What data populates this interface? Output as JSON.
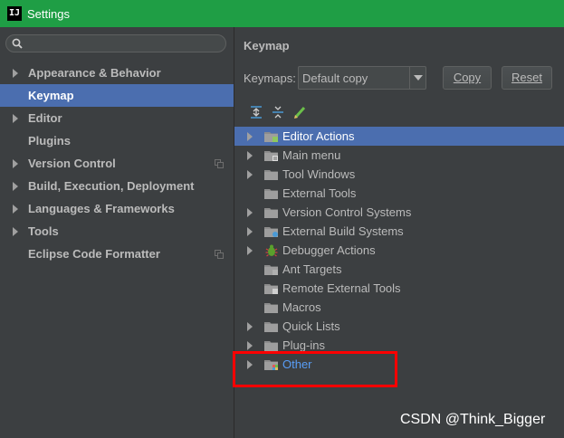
{
  "window": {
    "title": "Settings",
    "app_icon": "IJ"
  },
  "sidebar": {
    "search_placeholder": "",
    "items": [
      {
        "label": "Appearance & Behavior",
        "expandable": true,
        "selected": false
      },
      {
        "label": "Keymap",
        "expandable": false,
        "selected": true
      },
      {
        "label": "Editor",
        "expandable": true,
        "selected": false
      },
      {
        "label": "Plugins",
        "expandable": false,
        "selected": false
      },
      {
        "label": "Version Control",
        "expandable": true,
        "selected": false,
        "project_icon": true
      },
      {
        "label": "Build, Execution, Deployment",
        "expandable": true,
        "selected": false
      },
      {
        "label": "Languages & Frameworks",
        "expandable": true,
        "selected": false
      },
      {
        "label": "Tools",
        "expandable": true,
        "selected": false
      },
      {
        "label": "Eclipse Code Formatter",
        "expandable": false,
        "selected": false,
        "project_icon": true
      }
    ]
  },
  "main": {
    "heading": "Keymap",
    "keymaps_label": "Keymaps:",
    "keymap_selected": "Default copy",
    "copy_button": "Copy",
    "reset_button": "Reset",
    "toolbar_icons": [
      "expand-all-icon",
      "collapse-all-icon",
      "edit-icon"
    ],
    "tree": [
      {
        "label": "Editor Actions",
        "expandable": true,
        "selected": true,
        "icon": "folder-editor-icon"
      },
      {
        "label": "Main menu",
        "expandable": true,
        "icon": "folder-menu-icon"
      },
      {
        "label": "Tool Windows",
        "expandable": true,
        "icon": "folder-icon"
      },
      {
        "label": "External Tools",
        "expandable": false,
        "icon": "folder-icon"
      },
      {
        "label": "Version Control Systems",
        "expandable": true,
        "icon": "folder-icon"
      },
      {
        "label": "External Build Systems",
        "expandable": true,
        "icon": "folder-build-icon"
      },
      {
        "label": "Debugger Actions",
        "expandable": true,
        "icon": "bug-icon"
      },
      {
        "label": "Ant Targets",
        "expandable": false,
        "icon": "folder-ant-icon"
      },
      {
        "label": "Remote External Tools",
        "expandable": false,
        "icon": "folder-remote-icon"
      },
      {
        "label": "Macros",
        "expandable": false,
        "icon": "folder-icon"
      },
      {
        "label": "Quick Lists",
        "expandable": true,
        "icon": "folder-icon"
      },
      {
        "label": "Plug-ins",
        "expandable": true,
        "icon": "folder-icon"
      },
      {
        "label": "Other",
        "expandable": true,
        "icon": "folder-other-icon",
        "link": true
      }
    ]
  },
  "watermark": "CSDN @Think_Bigger",
  "colors": {
    "titlebar": "#1f9e45",
    "selection": "#4b6eaf",
    "background": "#3c3f41",
    "link": "#589df6",
    "highlight": "#ff0000"
  }
}
